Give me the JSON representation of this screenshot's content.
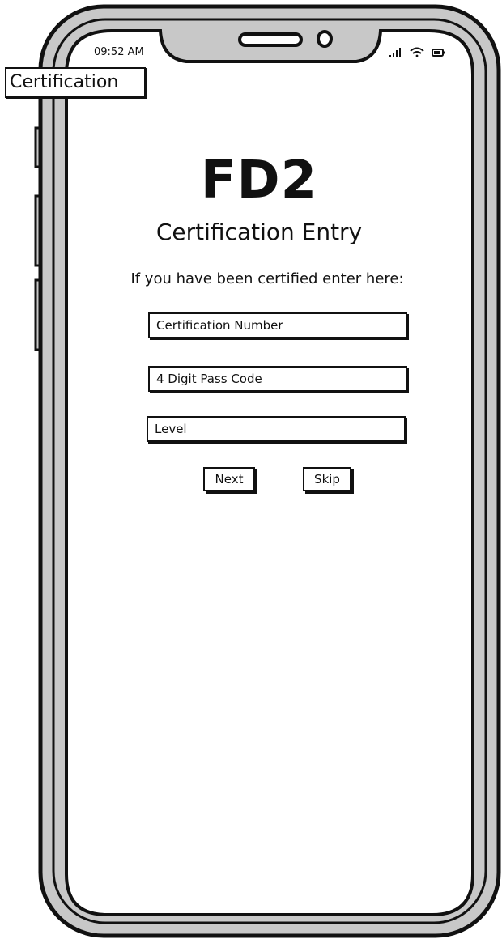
{
  "screen": {
    "label": "Certification"
  },
  "status_bar": {
    "time": "09:52 AM",
    "icons": [
      "signal-icon",
      "wifi-icon",
      "battery-icon"
    ]
  },
  "content": {
    "logo": "FD2",
    "title": "Certification Entry",
    "prompt": "If you have been certified enter here:"
  },
  "form": {
    "certification_number": {
      "placeholder": "Certification Number",
      "value": ""
    },
    "pass_code": {
      "placeholder": "4 Digit Pass Code",
      "value": ""
    },
    "level": {
      "placeholder": "Level",
      "value": ""
    }
  },
  "actions": {
    "next_label": "Next",
    "skip_label": "Skip"
  },
  "colors": {
    "frame": "#c8c8c8",
    "ink": "#111111",
    "screen": "#ffffff"
  }
}
